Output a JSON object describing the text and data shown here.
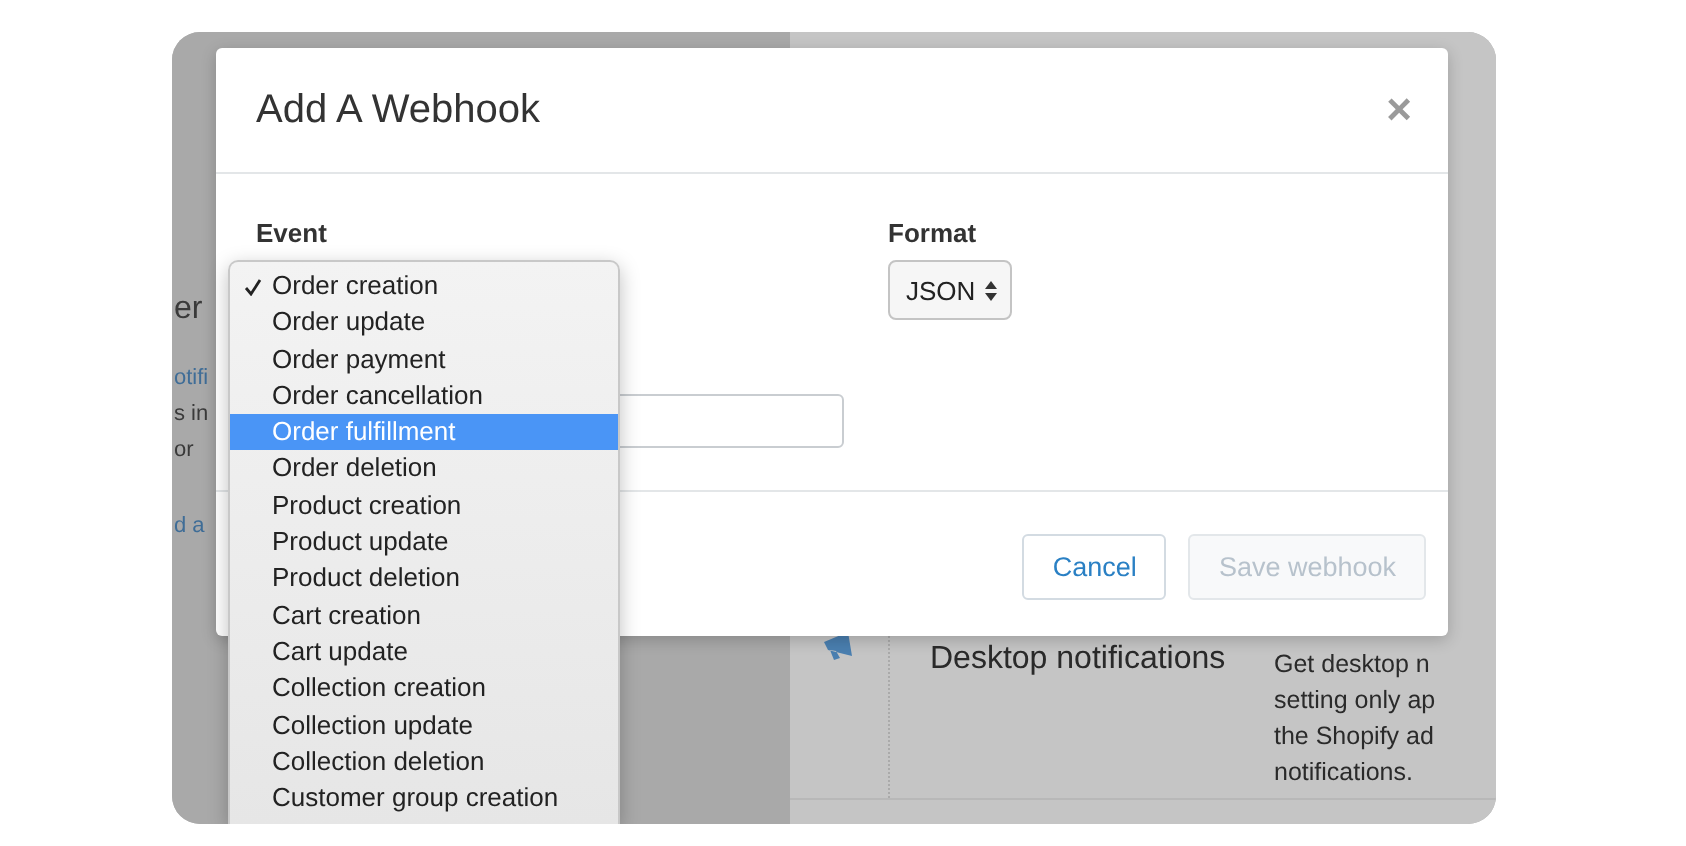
{
  "background_page": {
    "left_fragments": [
      {
        "text": "er",
        "kind": "heading"
      },
      {
        "text": "otifi",
        "kind": "link"
      },
      {
        "text": "s in",
        "kind": "text"
      },
      {
        "text": "or",
        "kind": "text"
      },
      {
        "text": "d a",
        "kind": "link"
      }
    ],
    "section_title": "Desktop notifications",
    "section_description_lines": [
      "Get desktop n",
      "setting only ap",
      "the Shopify ad",
      "notifications."
    ]
  },
  "dialog": {
    "title": "Add A Webhook",
    "close_label": "×",
    "event_label": "Event",
    "event_options": [
      {
        "label": "Order creation",
        "checked": true,
        "selected": false
      },
      {
        "label": "Order update",
        "checked": false,
        "selected": false
      },
      {
        "label": "Order payment",
        "checked": false,
        "selected": false
      },
      {
        "label": "Order cancellation",
        "checked": false,
        "selected": false
      },
      {
        "label": "Order fulfillment",
        "checked": false,
        "selected": true
      },
      {
        "label": "Order deletion",
        "checked": false,
        "selected": false
      },
      {
        "label": "Product creation",
        "checked": false,
        "selected": false
      },
      {
        "label": "Product update",
        "checked": false,
        "selected": false
      },
      {
        "label": "Product deletion",
        "checked": false,
        "selected": false
      },
      {
        "label": "Cart creation",
        "checked": false,
        "selected": false
      },
      {
        "label": "Cart update",
        "checked": false,
        "selected": false
      },
      {
        "label": "Collection creation",
        "checked": false,
        "selected": false
      },
      {
        "label": "Collection update",
        "checked": false,
        "selected": false
      },
      {
        "label": "Collection deletion",
        "checked": false,
        "selected": false
      },
      {
        "label": "Customer group creation",
        "checked": false,
        "selected": false
      }
    ],
    "format_label": "Format",
    "format_value": "JSON",
    "buttons": [
      {
        "label": "Cancel",
        "disabled": false
      },
      {
        "label": "Save webhook",
        "disabled": true
      }
    ]
  }
}
